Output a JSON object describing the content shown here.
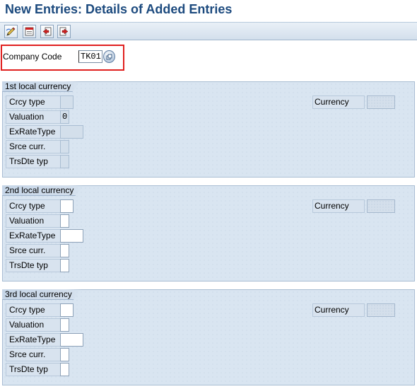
{
  "title": "New Entries: Details of Added Entries",
  "toolbar": {
    "buttons": [
      "edit-pencil-icon",
      "save-document-icon",
      "previous-entry-icon",
      "next-entry-icon"
    ]
  },
  "company_code": {
    "label": "Company Code",
    "value": "TK01"
  },
  "groups": [
    {
      "title": "1st local currency",
      "fields": {
        "crcy_type": {
          "label": "Crcy type",
          "value": ""
        },
        "valuation": {
          "label": "Valuation",
          "value": "0"
        },
        "exrate_type": {
          "label": "ExRateType",
          "value": ""
        },
        "srce_curr": {
          "label": "Srce curr.",
          "value": ""
        },
        "trsdte_typ": {
          "label": "TrsDte typ",
          "value": ""
        }
      },
      "currency": {
        "label": "Currency",
        "value": ""
      }
    },
    {
      "title": "2nd local currency",
      "fields": {
        "crcy_type": {
          "label": "Crcy type",
          "value": ""
        },
        "valuation": {
          "label": "Valuation",
          "value": ""
        },
        "exrate_type": {
          "label": "ExRateType",
          "value": ""
        },
        "srce_curr": {
          "label": "Srce curr.",
          "value": ""
        },
        "trsdte_typ": {
          "label": "TrsDte typ",
          "value": ""
        }
      },
      "currency": {
        "label": "Currency",
        "value": ""
      }
    },
    {
      "title": "3rd local currency",
      "fields": {
        "crcy_type": {
          "label": "Crcy type",
          "value": ""
        },
        "valuation": {
          "label": "Valuation",
          "value": ""
        },
        "exrate_type": {
          "label": "ExRateType",
          "value": ""
        },
        "srce_curr": {
          "label": "Srce curr.",
          "value": ""
        },
        "trsdte_typ": {
          "label": "TrsDte typ",
          "value": ""
        }
      },
      "currency": {
        "label": "Currency",
        "value": ""
      }
    }
  ],
  "colors": {
    "title": "#1c4a7e",
    "highlight": "#e0201f",
    "group_background": "#d9e5f1"
  }
}
